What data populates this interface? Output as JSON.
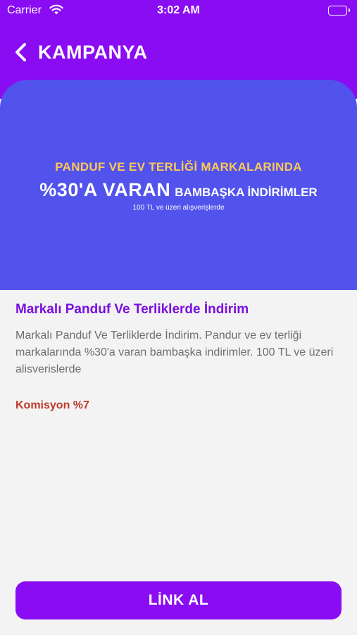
{
  "status_bar": {
    "carrier": "Carrier",
    "time": "3:02 AM"
  },
  "nav": {
    "title": "KAMPANYA",
    "back_icon": "chevron-left-icon"
  },
  "banner": {
    "line1": "PANDUF VE EV TERLİĞİ MARKALARINDA",
    "line2_big": "%30'A VARAN",
    "line2_small": "BAMBAŞKA İNDİRİMLER",
    "line3": "100 TL ve üzeri alışverişlerde",
    "colors": {
      "background": "#5153ec",
      "headline": "#ffc857"
    }
  },
  "campaign": {
    "title": "Markalı Panduf Ve Terliklerde İndirim",
    "description": "Markalı Panduf Ve Terliklerde İndirim. Pandur ve ev terliği markalarında %30'a varan bambaşka indirimler. 100 TL ve üzeri alisverislerde",
    "commission": "Komisyon %7"
  },
  "cta": {
    "label": "LİNK AL"
  },
  "colors": {
    "accent": "#8a0cf3",
    "title": "#7a0fe0",
    "commission": "#c0392b"
  }
}
